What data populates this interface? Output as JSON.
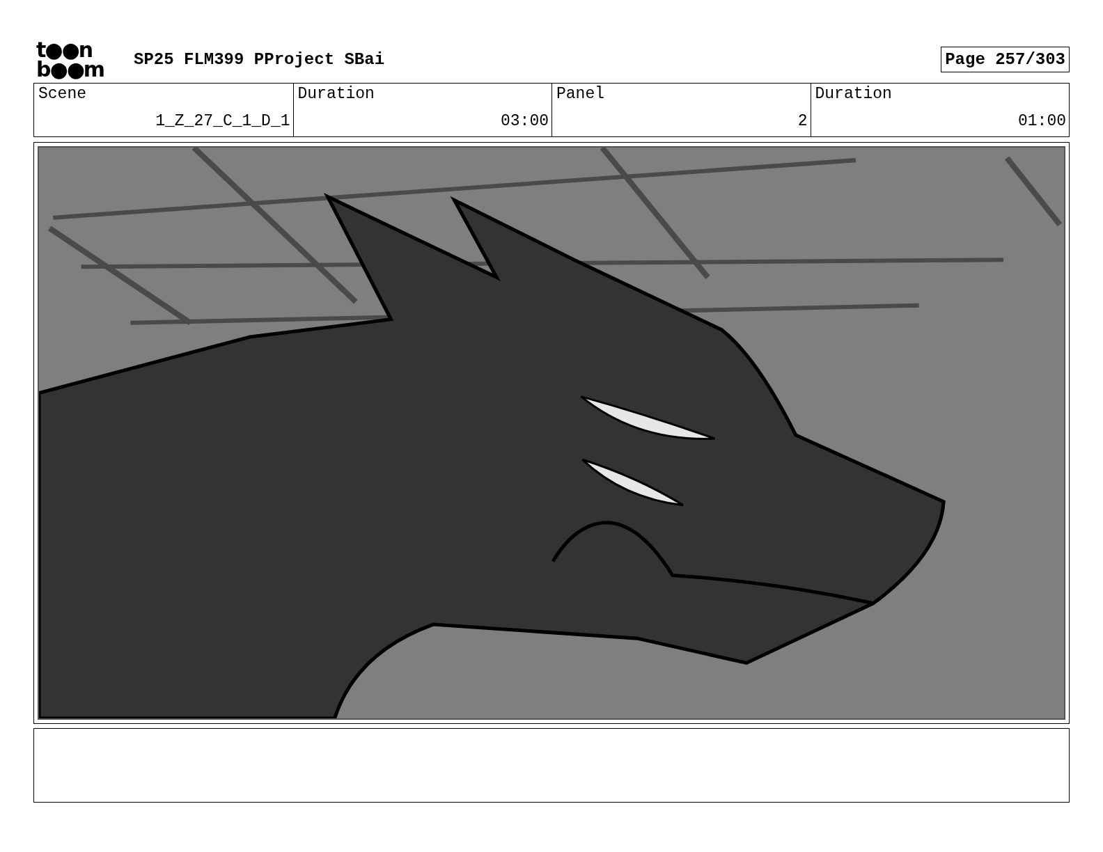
{
  "logo": {
    "lines": [
      "t●●n",
      "b●●m"
    ]
  },
  "title": "SP25 FLM399 PProject SBai",
  "page": "Page 257/303",
  "info_table": {
    "columns": [
      "Scene",
      "Duration",
      "Panel",
      "Duration"
    ],
    "rows": [
      [
        "1_Z_27_C_1_D_1",
        "03:00",
        "2",
        "01:00"
      ]
    ]
  }
}
